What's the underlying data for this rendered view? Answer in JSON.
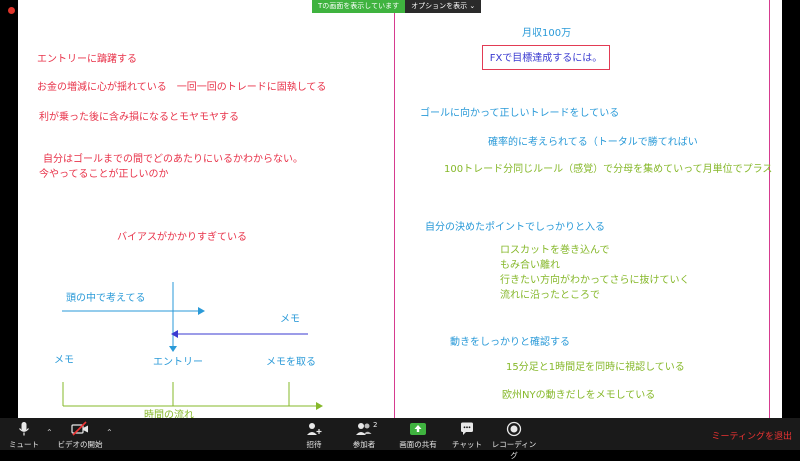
{
  "banner": {
    "sharing_text": "Tの画面を表示しています",
    "options_label": "オプションを表示"
  },
  "left": {
    "line1": "エントリーに躊躇する",
    "line2": "お金の増減に心が揺れている　一回一回のトレードに固執してる",
    "line3": "利が乗った後に含み損になるとモヤモヤする",
    "line4": "自分はゴールまでの間でどのあたりにいるかわからない。",
    "line5": "今やってることが正しいのか",
    "line6": "バイアスがかかりすぎている",
    "diagram": {
      "head_label": "頭の中で考えてる",
      "memo_right": "メモ",
      "memo_left": "メモ",
      "entry": "エントリー",
      "memo_take": "メモを取る",
      "time_flow": "時間の流れ"
    }
  },
  "right": {
    "income": "月収100万",
    "goal_box": "FXで目標達成するには。",
    "goal_line": "ゴールに向かって正しいトレードをしている",
    "prob": "確率的に考えられてる（トータルで勝てればい",
    "hundred": "100トレード分同じルール（感覚）で分母を集めていって月単位でプラス",
    "entry_point": "自分の決めたポイントでしっかりと入る",
    "bullets": [
      "ロスカットを巻き込んで",
      "もみ合い離れ",
      "行きたい方向がわかってさらに抜けていく",
      "流れに沿ったところで"
    ],
    "confirm": "動きをしっかりと確認する",
    "timeframes": "15分足と1時間足を同時に視認している",
    "eu_ny": "欧州NYの動きだしをメモしている"
  },
  "toolbar": {
    "mute": "ミュート",
    "video": "ビデオの開始",
    "invite": "招待",
    "participants": "参加者",
    "participants_count": "2",
    "share": "画面の共有",
    "chat": "チャット",
    "record": "レコーディング",
    "leave": "ミーティングを退出"
  },
  "colors": {
    "red": "#e8334a",
    "blue": "#2a9ad8",
    "green": "#86b82a",
    "pink_divider": "#d63b8f",
    "share_green": "#3fb33f"
  }
}
